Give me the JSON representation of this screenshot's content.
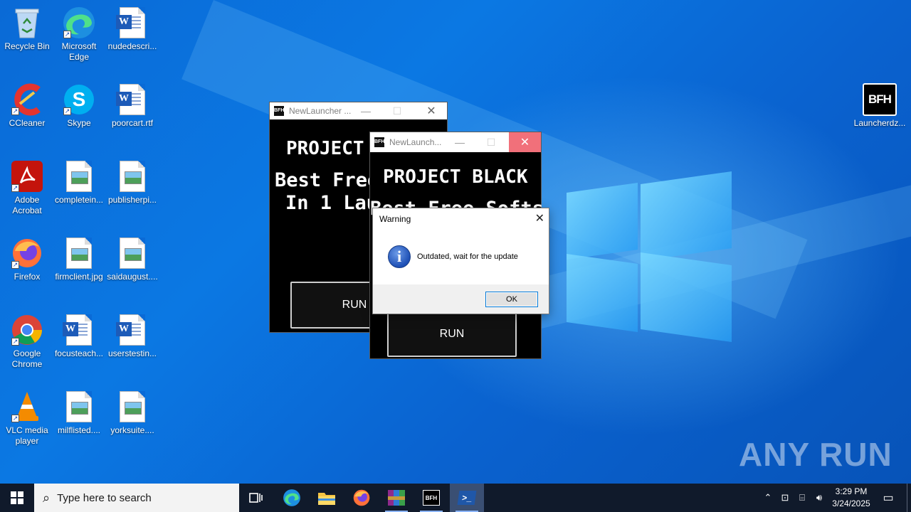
{
  "desktop": {
    "icons": [
      {
        "label": "Recycle Bin",
        "icon": "recycle-bin-icon"
      },
      {
        "label": "Microsoft Edge",
        "icon": "edge-icon"
      },
      {
        "label": "nudedescri...",
        "icon": "word-doc-icon"
      },
      {
        "label": "CCleaner",
        "icon": "ccleaner-icon"
      },
      {
        "label": "Skype",
        "icon": "skype-icon"
      },
      {
        "label": "poorcart.rtf",
        "icon": "word-doc-icon"
      },
      {
        "label": "Adobe Acrobat",
        "icon": "acrobat-icon"
      },
      {
        "label": "completein...",
        "icon": "image-file-icon"
      },
      {
        "label": "publisherpi...",
        "icon": "image-file-icon"
      },
      {
        "label": "Firefox",
        "icon": "firefox-icon"
      },
      {
        "label": "firmclient.jpg",
        "icon": "image-file-icon"
      },
      {
        "label": "saidaugust....",
        "icon": "image-file-icon"
      },
      {
        "label": "Google Chrome",
        "icon": "chrome-icon"
      },
      {
        "label": "focusteach...",
        "icon": "word-doc-icon"
      },
      {
        "label": "userstestin...",
        "icon": "word-doc-icon"
      },
      {
        "label": "VLC media player",
        "icon": "vlc-icon"
      },
      {
        "label": "milflisted....",
        "icon": "image-file-icon"
      },
      {
        "label": "yorksuite....",
        "icon": "image-file-icon"
      },
      {
        "label": "Launcherdz...",
        "icon": "bfh-launcher-icon"
      }
    ]
  },
  "window_back": {
    "title": "NewLauncher ...",
    "banner_title": "PROJECT",
    "banner_line1": "Best Free",
    "banner_line2": "In 1 Lau",
    "run_label": "RUN"
  },
  "window_front": {
    "title": "NewLaunch...",
    "banner_title": "PROJECT BLACK",
    "banner_line1": "Best Free Softs",
    "run_label": "RUN"
  },
  "dialog": {
    "title": "Warning",
    "message": "Outdated, wait for the update",
    "ok_label": "OK",
    "icon": "info-icon"
  },
  "watermark": {
    "text": "ANY RUN"
  },
  "taskbar": {
    "search_placeholder": "Type here to search",
    "clock_time": "3:29 PM",
    "clock_date": "3/24/2025",
    "items": [
      "start-button",
      "task-view",
      "edge",
      "file-explorer",
      "firefox",
      "winrar",
      "bfh-launcher",
      "powershell"
    ]
  },
  "colors": {
    "wallpaper": "#0a6ad6",
    "taskbar": "#101a2b",
    "launcher_bg": "#000000",
    "close_hover": "#f1707a",
    "active_task": "#3a4f73"
  }
}
